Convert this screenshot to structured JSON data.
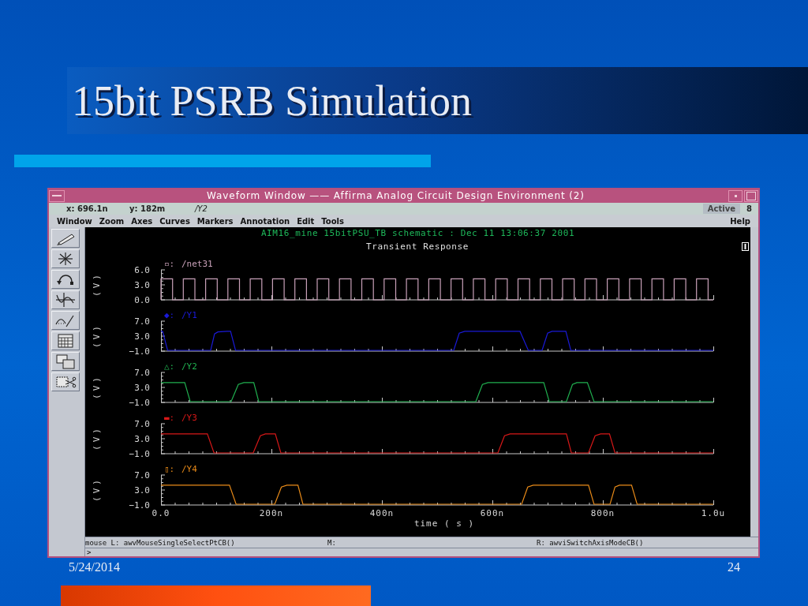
{
  "slide": {
    "title": "15bit PSRB Simulation",
    "date": "5/24/2014",
    "page_number": "24"
  },
  "window": {
    "title": "Waveform Window —— Affirma Analog Circuit Design Environment (2)",
    "status": {
      "x": "x: 696.1n",
      "y": "y: 182m",
      "trace": "/Y2",
      "mode": "Active",
      "count": "8"
    },
    "menu": [
      "Window",
      "Zoom",
      "Axes",
      "Curves",
      "Markers",
      "Annotation",
      "Edit",
      "Tools"
    ],
    "help": "Help",
    "tools": [
      {
        "kind": "pencil"
      },
      {
        "kind": "asterisk"
      },
      {
        "kind": "arrow"
      },
      {
        "kind": "sine"
      },
      {
        "kind": "curves"
      },
      {
        "kind": "calculator"
      },
      {
        "kind": "windows"
      },
      {
        "kind": "scissors"
      }
    ],
    "plot": {
      "header": "AIM16_mine 15bitPSU_TB schematic : Dec 11 13:06:37 2001",
      "title": "Transient Response",
      "strips": [
        {
          "marker": "▫:",
          "name": "/net31",
          "color": "#c8a0b8",
          "ylabel": "(V)",
          "yticks": [
            "6.0",
            "3.0",
            "0.0"
          ]
        },
        {
          "marker": "◆:",
          "name": "/Y1",
          "color": "#1a1ad8",
          "ylabel": "(V)",
          "yticks": [
            "7.0",
            "3.0",
            "−1.0"
          ]
        },
        {
          "marker": "△:",
          "name": "/Y2",
          "color": "#20b050",
          "ylabel": "(V)",
          "yticks": [
            "7.0",
            "3.0",
            "−1.0"
          ]
        },
        {
          "marker": "▬:",
          "name": "/Y3",
          "color": "#d81818",
          "ylabel": "(V)",
          "yticks": [
            "7.0",
            "3.0",
            "−1.0"
          ]
        },
        {
          "marker": "▯:",
          "name": "/Y4",
          "color": "#e88a18",
          "ylabel": "(V)",
          "yticks": [
            "7.0",
            "3.0",
            "−1.0"
          ]
        }
      ],
      "x_axis": {
        "ticks": [
          "0.0",
          "200n",
          "400n",
          "600n",
          "800n",
          "1.0u"
        ],
        "label": "time ( s )"
      }
    },
    "mouse": {
      "left": "mouse L: awvMouseSingleSelectPtCB()",
      "middle": "M:",
      "right": "R: awviSwitchAxisModeCB()"
    },
    "prompt": ">"
  }
}
